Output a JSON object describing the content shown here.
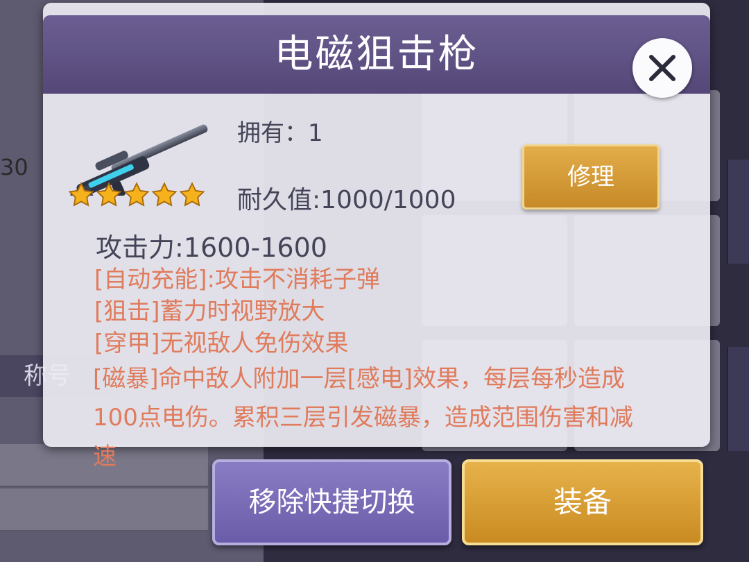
{
  "dialog": {
    "title": "电磁狙击枪",
    "owned": "拥有：1",
    "durability": "耐久值:1000/1000",
    "attack": "攻击力:1600-1600",
    "stars": 5,
    "repair_label": "修理",
    "skills": [
      "[自动充能]:攻击不消耗子弹",
      "[狙击]蓄力时视野放大",
      "[穿甲]无视敌人免伤效果",
      "[磁暴]命中敌人附加一层[感电]效果，每层每秒造成100点电伤。累积三层引发磁暴，造成范围伤害和减速"
    ]
  },
  "buttons": {
    "remove_label": "移除快捷切换",
    "equip_label": "装备"
  },
  "background": {
    "side_tag": "称号",
    "side_number": "30"
  },
  "colors": {
    "header": "#5f5286",
    "skill_text": "#e07b5c",
    "gold": "#d49a34",
    "purple_button": "#7a6cb8"
  },
  "icons": [
    "close-icon",
    "sniper-rifle-icon",
    "star-icon"
  ]
}
